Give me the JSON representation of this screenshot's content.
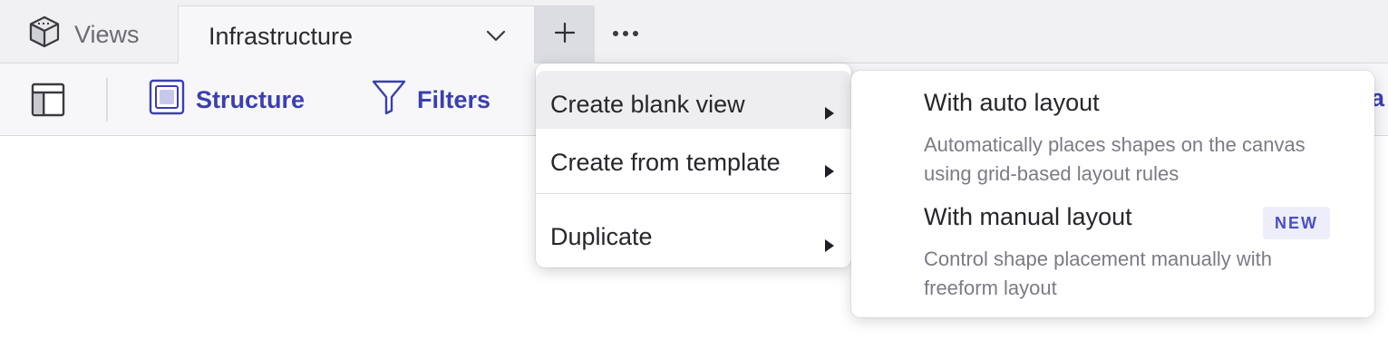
{
  "tabs": {
    "views_label": "Views",
    "active_label": "Infrastructure",
    "add_icon": "plus-icon",
    "more_icon": "ellipsis-icon"
  },
  "toolbar": {
    "structure_label": "Structure",
    "filters_label": "Filters",
    "clipped_label": "a"
  },
  "menu": {
    "items": [
      {
        "label": "Create blank view",
        "has_submenu": true,
        "active": true
      },
      {
        "label": "Create from template",
        "has_submenu": true
      },
      {
        "label": "Duplicate",
        "has_submenu": true
      }
    ]
  },
  "submenu": {
    "items": [
      {
        "title": "With auto layout",
        "description": "Automatically places shapes on the canvas using grid-based layout rules"
      },
      {
        "title": "With manual layout",
        "badge": "NEW",
        "description": "Control shape placement manually with freeform layout"
      }
    ]
  },
  "colors": {
    "accent": "#3b3fb0",
    "badge_bg": "#eeeefa",
    "menu_hover": "#eeeef1"
  }
}
